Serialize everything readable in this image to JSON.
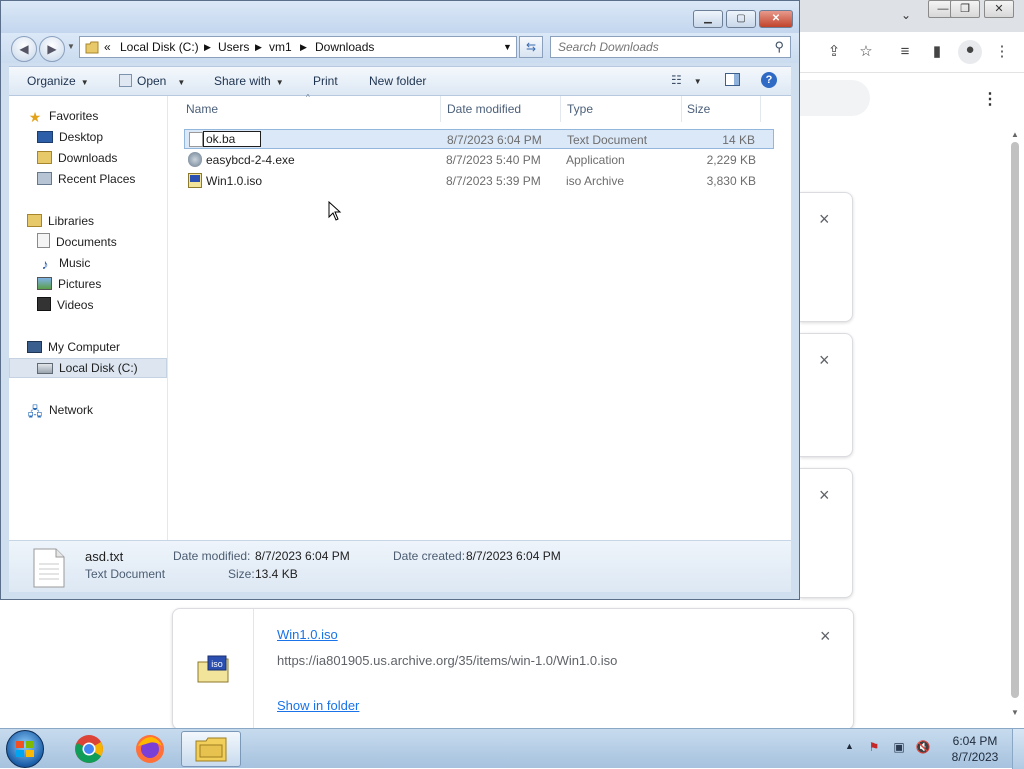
{
  "explorer": {
    "address": {
      "overflow": "«",
      "crumbs": [
        "Local Disk (C:)",
        "Users",
        "vm1",
        "Downloads"
      ]
    },
    "search_placeholder": "Search Downloads",
    "commands": {
      "organize": "Organize",
      "open": "Open",
      "share_with": "Share with",
      "print": "Print",
      "new_folder": "New folder"
    },
    "nav": {
      "favorites": "Favorites",
      "desktop": "Desktop",
      "downloads": "Downloads",
      "recent_places": "Recent Places",
      "libraries": "Libraries",
      "documents": "Documents",
      "music": "Music",
      "pictures": "Pictures",
      "videos": "Videos",
      "my_computer": "My Computer",
      "local_disk": "Local Disk (C:)",
      "network": "Network"
    },
    "columns": {
      "name": "Name",
      "date_modified": "Date modified",
      "type": "Type",
      "size": "Size"
    },
    "files": [
      {
        "name": "ok.ba",
        "date": "8/7/2023 6:04 PM",
        "type": "Text Document",
        "size": "14 KB"
      },
      {
        "name": "easybcd-2-4.exe",
        "date": "8/7/2023 5:40 PM",
        "type": "Application",
        "size": "2,229 KB"
      },
      {
        "name": "Win1.0.iso",
        "date": "8/7/2023 5:39 PM",
        "type": "iso Archive",
        "size": "3,830 KB"
      }
    ],
    "details": {
      "filename": "asd.txt",
      "filetype": "Text Document",
      "date_modified_label": "Date modified:",
      "date_modified": "8/7/2023 6:04 PM",
      "date_created_label": "Date created:",
      "date_created": "8/7/2023 6:04 PM",
      "size_label": "Size:",
      "size": "13.4 KB"
    }
  },
  "downloads": {
    "file": "Win1.0.iso",
    "url": "https://ia801905.us.archive.org/35/items/win-1.0/Win1.0.iso",
    "show_in_folder": "Show in folder",
    "close": "×"
  },
  "taskbar": {
    "time": "6:04 PM",
    "date": "8/7/2023"
  },
  "colors": {
    "link": "#1a73e8",
    "explorer_frame": "#cfdff0",
    "selection": "#dbe8f8"
  }
}
